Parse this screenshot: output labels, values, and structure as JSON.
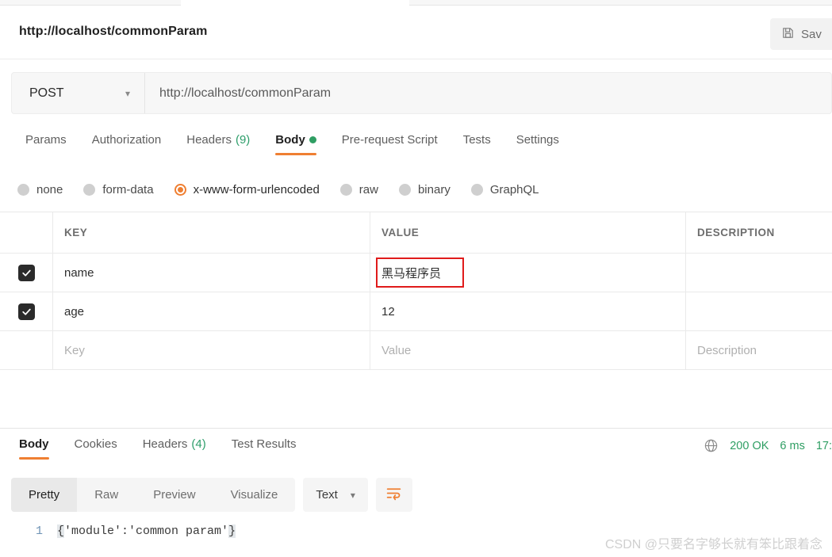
{
  "window": {
    "request_title": "http://localhost/commonParam",
    "save_label": "Sav",
    "save_icon": "floppy-disk-icon"
  },
  "url_bar": {
    "method": "POST",
    "method_chevron": "chevron-down-icon",
    "url": "http://localhost/commonParam"
  },
  "request_tabs": [
    {
      "label": "Params",
      "count": "",
      "active": false,
      "dot": false
    },
    {
      "label": "Authorization",
      "count": "",
      "active": false,
      "dot": false
    },
    {
      "label": "Headers",
      "count": "(9)",
      "active": false,
      "dot": false
    },
    {
      "label": "Body",
      "count": "",
      "active": true,
      "dot": true
    },
    {
      "label": "Pre-request Script",
      "count": "",
      "active": false,
      "dot": false
    },
    {
      "label": "Tests",
      "count": "",
      "active": false,
      "dot": false
    },
    {
      "label": "Settings",
      "count": "",
      "active": false,
      "dot": false
    }
  ],
  "body_types": [
    {
      "label": "none",
      "selected": false
    },
    {
      "label": "form-data",
      "selected": false
    },
    {
      "label": "x-www-form-urlencoded",
      "selected": true
    },
    {
      "label": "raw",
      "selected": false
    },
    {
      "label": "binary",
      "selected": false
    },
    {
      "label": "GraphQL",
      "selected": false
    }
  ],
  "params_table": {
    "headers": [
      "KEY",
      "VALUE",
      "DESCRIPTION"
    ],
    "rows": [
      {
        "checked": true,
        "key": "name",
        "value": "黑马程序员",
        "description": "",
        "placeholder": false,
        "highlighted": true
      },
      {
        "checked": true,
        "key": "age",
        "value": "12",
        "description": "",
        "placeholder": false,
        "highlighted": false
      },
      {
        "checked": false,
        "key": "Key",
        "value": "Value",
        "description": "Description",
        "placeholder": true,
        "highlighted": false
      }
    ]
  },
  "response": {
    "tabs": [
      {
        "label": "Body",
        "count": "",
        "active": true
      },
      {
        "label": "Cookies",
        "count": "",
        "active": false
      },
      {
        "label": "Headers",
        "count": "(4)",
        "active": false
      },
      {
        "label": "Test Results",
        "count": "",
        "active": false
      }
    ],
    "status": "200 OK",
    "time": "6 ms",
    "size": "17:",
    "globe_icon": "globe-icon",
    "view_modes": [
      {
        "label": "Pretty",
        "active": true
      },
      {
        "label": "Raw",
        "active": false
      },
      {
        "label": "Preview",
        "active": false
      },
      {
        "label": "Visualize",
        "active": false
      }
    ],
    "format": "Text",
    "format_chevron": "chevron-down-icon",
    "wrap_icon": "wrap-text-icon",
    "code": {
      "line_number": "1",
      "open_brace": "{",
      "content": "'module':'common param'",
      "close_brace": "}"
    }
  },
  "watermark": "CSDN @只要名字够长就有笨比跟着念",
  "colors": {
    "accent": "#ef7f32",
    "success": "#2f9e63",
    "annotation": "#e01b1b"
  }
}
